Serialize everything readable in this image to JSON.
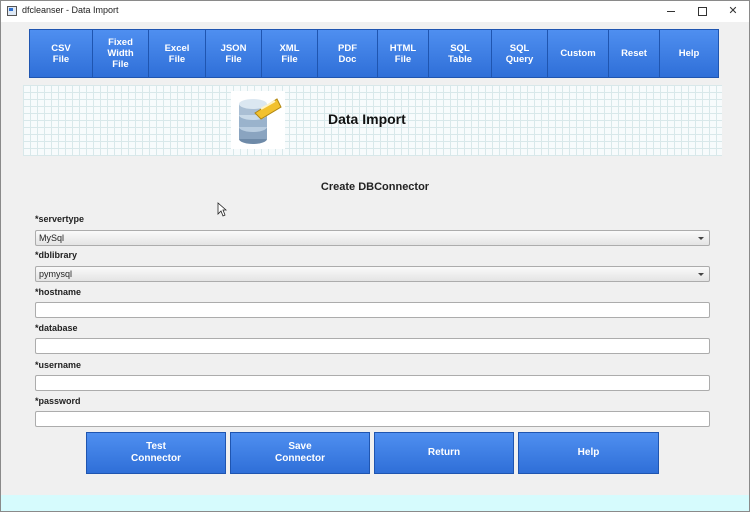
{
  "window": {
    "title": "dfcleanser - Data Import"
  },
  "toolbar": {
    "buttons": [
      {
        "label": "CSV\nFile"
      },
      {
        "label": "Fixed\nWidth\nFile"
      },
      {
        "label": "Excel\nFile"
      },
      {
        "label": "JSON\nFile"
      },
      {
        "label": "XML\nFile"
      },
      {
        "label": "PDF\nDoc"
      },
      {
        "label": "HTML\nFile"
      },
      {
        "label": "SQL\nTable"
      },
      {
        "label": "SQL\nQuery"
      },
      {
        "label": "Custom"
      },
      {
        "label": "Reset"
      },
      {
        "label": "Help"
      }
    ]
  },
  "banner": {
    "title": "Data Import",
    "icon": "database-icon"
  },
  "form": {
    "title": "Create DBConnector",
    "fields": {
      "servertype": {
        "label": "*servertype",
        "value": "MySql"
      },
      "dblibrary": {
        "label": "*dblibrary",
        "value": "pymysql"
      },
      "hostname": {
        "label": "*hostname",
        "value": ""
      },
      "database": {
        "label": "*database",
        "value": ""
      },
      "username": {
        "label": "*username",
        "value": ""
      },
      "password": {
        "label": "*password",
        "value": ""
      }
    }
  },
  "actions": {
    "test": "Test\nConnector",
    "save": "Save\nConnector",
    "return": "Return",
    "help": "Help"
  },
  "colors": {
    "button": "#3a7be0",
    "button_border": "#1f55b0",
    "bottom_strip": "#d6fbfd"
  }
}
